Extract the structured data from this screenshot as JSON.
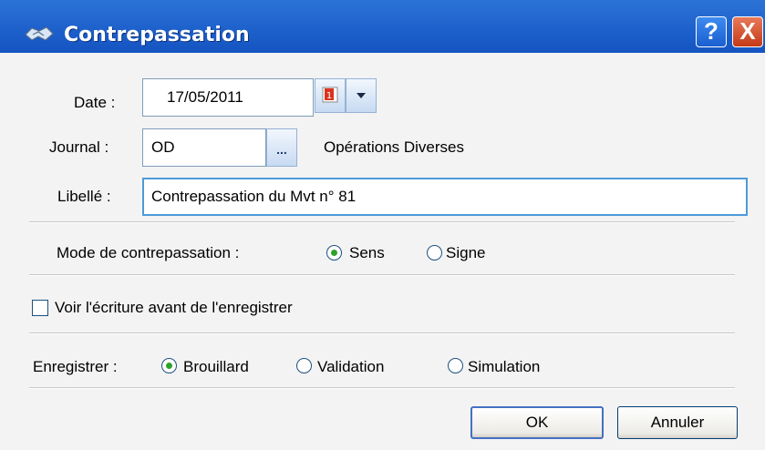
{
  "window": {
    "title": "Contrepassation",
    "help_label": "?",
    "close_label": "X"
  },
  "form": {
    "date": {
      "label": "Date :",
      "value": "17/05/2011"
    },
    "journal": {
      "label": "Journal :",
      "value": "OD",
      "browse_label": "...",
      "description": "Opérations Diverses"
    },
    "libelle": {
      "label": "Libellé :",
      "value": "Contrepassation du Mvt n° 81"
    },
    "mode": {
      "label": "Mode de contrepassation :",
      "options": [
        {
          "label": "Sens",
          "selected": true
        },
        {
          "label": "Signe",
          "selected": false
        }
      ]
    },
    "preview": {
      "label": "Voir l'écriture avant de l'enregistrer",
      "checked": false
    },
    "enregistrer": {
      "label": "Enregistrer :",
      "options": [
        {
          "label": "Brouillard",
          "selected": true
        },
        {
          "label": "Validation",
          "selected": false
        },
        {
          "label": "Simulation",
          "selected": false
        }
      ]
    }
  },
  "buttons": {
    "ok": "OK",
    "cancel": "Annuler"
  },
  "colors": {
    "titlebar": "#1b5dc9",
    "radio_dot": "#2fa12a",
    "calendar_icon": "#d9321e"
  },
  "icons": {
    "window": "handshake-icon",
    "calendar": "calendar-icon",
    "dropdown": "chevron-down-icon"
  }
}
